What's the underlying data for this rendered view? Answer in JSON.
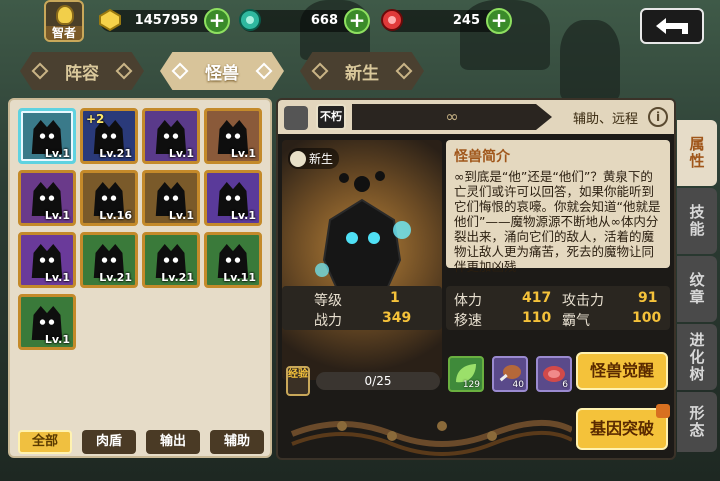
{
  "player": {
    "title": "智者"
  },
  "resources": [
    {
      "name": "gold",
      "value": "1457959",
      "color": "#f5d24a"
    },
    {
      "name": "green-gem",
      "value": "668",
      "color": "#2fb8a0"
    },
    {
      "name": "red-gem",
      "value": "245",
      "color": "#e03a3a"
    }
  ],
  "tabs": [
    {
      "label": "阵容",
      "active": false
    },
    {
      "label": "怪兽",
      "active": true
    },
    {
      "label": "新生",
      "active": false
    }
  ],
  "monsters": [
    {
      "level": "Lv.1",
      "bg": "#3a7a8a",
      "selected": true,
      "plus": ""
    },
    {
      "level": "Lv.21",
      "bg": "#2a3a7a",
      "selected": false,
      "plus": "+2"
    },
    {
      "level": "Lv.1",
      "bg": "#5a3a8a",
      "selected": false,
      "plus": ""
    },
    {
      "level": "Lv.1",
      "bg": "#8a5a3a",
      "selected": false,
      "plus": ""
    },
    {
      "level": "Lv.1",
      "bg": "#6a3a8a",
      "selected": false,
      "plus": ""
    },
    {
      "level": "Lv.16",
      "bg": "#7a5a2a",
      "selected": false,
      "plus": ""
    },
    {
      "level": "Lv.1",
      "bg": "#7a5a2a",
      "selected": false,
      "plus": ""
    },
    {
      "level": "Lv.1",
      "bg": "#5a3a9a",
      "selected": false,
      "plus": ""
    },
    {
      "level": "Lv.1",
      "bg": "#6a3a9a",
      "selected": false,
      "plus": ""
    },
    {
      "level": "Lv.21",
      "bg": "#3a7a3a",
      "selected": false,
      "plus": ""
    },
    {
      "level": "Lv.21",
      "bg": "#3a7a3a",
      "selected": false,
      "plus": ""
    },
    {
      "level": "Lv.11",
      "bg": "#3a7a3a",
      "selected": false,
      "plus": ""
    },
    {
      "level": "Lv.1",
      "bg": "#3a7a3a",
      "selected": false,
      "plus": ""
    }
  ],
  "filters": [
    {
      "label": "全部",
      "active": true
    },
    {
      "label": "肉盾",
      "active": false
    },
    {
      "label": "输出",
      "active": false
    },
    {
      "label": "辅助",
      "active": false
    }
  ],
  "detail": {
    "badge": "不朽",
    "infinity": "∞",
    "type": "辅助、远程",
    "info_icon": "i",
    "newborn": "新生",
    "desc_title": "怪兽简介",
    "desc_text": "∞到底是“他”还是“他们”？黄泉下的亡灵们或许可以回答，如果你能听到它们悔恨的哀嚎。你就会知道“他就是他们”——魔物源源不断地从∞体内分裂出来，涌向它们的敌人，活着的魔物让敌人更为痛苦，死去的魔物让同伴更加凶残",
    "level_label": "等级",
    "level_value": "1",
    "power_label": "战力",
    "power_value": "349",
    "hp_label": "体力",
    "hp_value": "417",
    "atk_label": "攻击力",
    "atk_value": "91",
    "spd_label": "移速",
    "spd_value": "110",
    "dom_label": "霸气",
    "dom_value": "100",
    "exp_label": "经验",
    "exp_value": "0/25",
    "items": [
      {
        "name": "leaf-item",
        "count": "129",
        "color": "#3f8a3a"
      },
      {
        "name": "meat-item",
        "count": "40",
        "color": "#5a4a8a"
      },
      {
        "name": "steak-item",
        "count": "6",
        "color": "#5a4a8a"
      }
    ],
    "awaken_label": "怪兽觉醒",
    "gene_label": "基因突破"
  },
  "side_tabs": [
    {
      "label": "属性",
      "active": true
    },
    {
      "label": "技能",
      "active": false
    },
    {
      "label": "纹章",
      "active": false
    },
    {
      "label": "进化树",
      "active": false
    },
    {
      "label": "形态",
      "active": false
    }
  ]
}
